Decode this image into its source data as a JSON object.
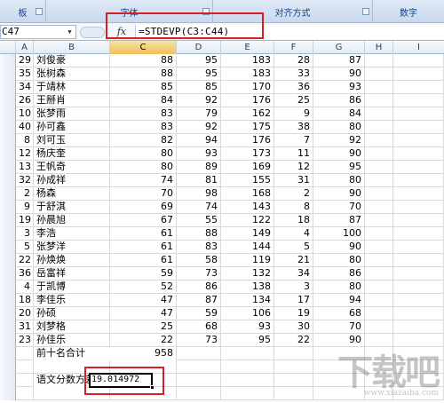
{
  "ribbon": {
    "groups": [
      {
        "label": "板",
        "launcher": true
      },
      {
        "label": "字体",
        "launcher": true
      },
      {
        "label": "对齐方式",
        "launcher": true
      },
      {
        "label": "数字",
        "launcher": false
      }
    ]
  },
  "formula_bar": {
    "name_box": "C47",
    "fx_icon": "function-icon",
    "formula": "=STDEVP(C3:C44)"
  },
  "columns": [
    "A",
    "B",
    "C",
    "D",
    "E",
    "F",
    "G",
    "H",
    "I"
  ],
  "selected_column": "C",
  "rows": [
    {
      "a": "29",
      "b": "刘俊豪",
      "c": "88",
      "d": "95",
      "e": "183",
      "f": "28",
      "g": "87"
    },
    {
      "a": "35",
      "b": "张树森",
      "c": "88",
      "d": "95",
      "e": "183",
      "f": "33",
      "g": "90"
    },
    {
      "a": "34",
      "b": "于靖林",
      "c": "85",
      "d": "85",
      "e": "170",
      "f": "36",
      "g": "93"
    },
    {
      "a": "26",
      "b": "王掰肖",
      "c": "84",
      "d": "92",
      "e": "176",
      "f": "25",
      "g": "86"
    },
    {
      "a": "10",
      "b": "张梦雨",
      "c": "83",
      "d": "79",
      "e": "162",
      "f": "9",
      "g": "84"
    },
    {
      "a": "40",
      "b": "孙可鑫",
      "c": "83",
      "d": "92",
      "e": "175",
      "f": "38",
      "g": "80"
    },
    {
      "a": "8",
      "b": "刘可玉",
      "c": "82",
      "d": "94",
      "e": "176",
      "f": "7",
      "g": "92"
    },
    {
      "a": "12",
      "b": "杨庆奎",
      "c": "80",
      "d": "93",
      "e": "173",
      "f": "11",
      "g": "90"
    },
    {
      "a": "13",
      "b": "王帆奇",
      "c": "80",
      "d": "89",
      "e": "169",
      "f": "12",
      "g": "95"
    },
    {
      "a": "32",
      "b": "孙成祥",
      "c": "74",
      "d": "81",
      "e": "155",
      "f": "31",
      "g": "80"
    },
    {
      "a": "2",
      "b": "杨森",
      "c": "70",
      "d": "98",
      "e": "168",
      "f": "2",
      "g": "90"
    },
    {
      "a": "9",
      "b": "于舒淇",
      "c": "69",
      "d": "74",
      "e": "143",
      "f": "8",
      "g": "70"
    },
    {
      "a": "19",
      "b": "孙晨旭",
      "c": "67",
      "d": "55",
      "e": "122",
      "f": "18",
      "g": "87"
    },
    {
      "a": "3",
      "b": "李浩",
      "c": "61",
      "d": "88",
      "e": "149",
      "f": "4",
      "g": "100"
    },
    {
      "a": "5",
      "b": "张梦洋",
      "c": "61",
      "d": "83",
      "e": "144",
      "f": "5",
      "g": "90"
    },
    {
      "a": "22",
      "b": "孙焕焕",
      "c": "61",
      "d": "58",
      "e": "119",
      "f": "21",
      "g": "80"
    },
    {
      "a": "36",
      "b": "岳富祥",
      "c": "59",
      "d": "73",
      "e": "132",
      "f": "34",
      "g": "86"
    },
    {
      "a": "4",
      "b": "于凯博",
      "c": "52",
      "d": "86",
      "e": "138",
      "f": "3",
      "g": "80"
    },
    {
      "a": "18",
      "b": "李佳乐",
      "c": "47",
      "d": "87",
      "e": "134",
      "f": "17",
      "g": "94"
    },
    {
      "a": "20",
      "b": "孙硕",
      "c": "47",
      "d": "59",
      "e": "106",
      "f": "19",
      "g": "68"
    },
    {
      "a": "31",
      "b": "刘梦格",
      "c": "25",
      "d": "68",
      "e": "93",
      "f": "30",
      "g": "70"
    },
    {
      "a": "23",
      "b": "孙佳乐",
      "c": "22",
      "d": "73",
      "e": "95",
      "f": "22",
      "g": "90"
    }
  ],
  "summary": {
    "top10_label": "前十名合计",
    "top10_value": "958",
    "stdev_label": "语文分数方差",
    "stdev_value": "19.014972"
  },
  "watermark": {
    "text": "下载吧",
    "sub": "www.xiazaiba.com"
  }
}
